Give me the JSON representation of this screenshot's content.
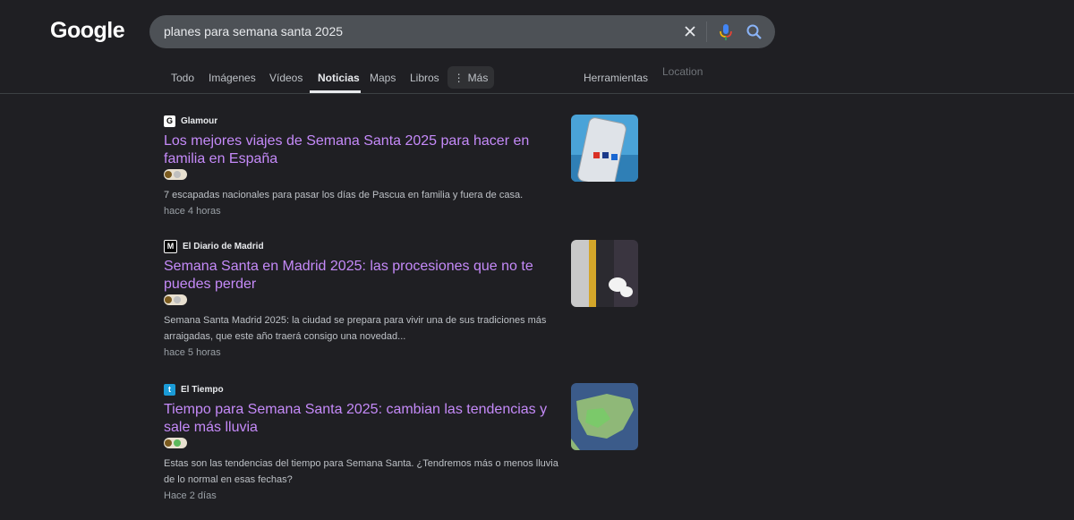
{
  "logo": "Google",
  "search": {
    "query": "planes para semana santa 2025"
  },
  "tabs": [
    {
      "label": "Todo"
    },
    {
      "label": "Imágenes"
    },
    {
      "label": "Vídeos"
    },
    {
      "label": "Noticias"
    },
    {
      "label": "Maps"
    },
    {
      "label": "Libros"
    }
  ],
  "more_label": "Más",
  "tools_label": "Herramientas",
  "location_label": "Location",
  "results": [
    {
      "source": "Glamour",
      "favicon_letter": "G",
      "title": "Los mejores viajes de Semana Santa 2025 para hacer en familia en España",
      "snippet": "7 escapadas nacionales para pasar los días de Pascua en familia y fuera de casa.",
      "time": "hace 4 horas"
    },
    {
      "source": "El Diario de Madrid",
      "favicon_letter": "M",
      "title": "Semana Santa en Madrid 2025: las procesiones que no te puedes perder",
      "snippet": "Semana Santa Madrid 2025: la ciudad se prepara para vivir una de sus tradiciones más arraigadas, que este año traerá consigo una novedad...",
      "time": "hace 5 horas"
    },
    {
      "source": "El Tiempo",
      "favicon_letter": "t",
      "title": "Tiempo para Semana Santa 2025: cambian las tendencias y sale más lluvia",
      "snippet": "Estas son las tendencias del tiempo para Semana Santa. ¿Tendremos más o menos lluvia de lo normal en esas fechas?",
      "time": "Hace 2 días"
    }
  ]
}
